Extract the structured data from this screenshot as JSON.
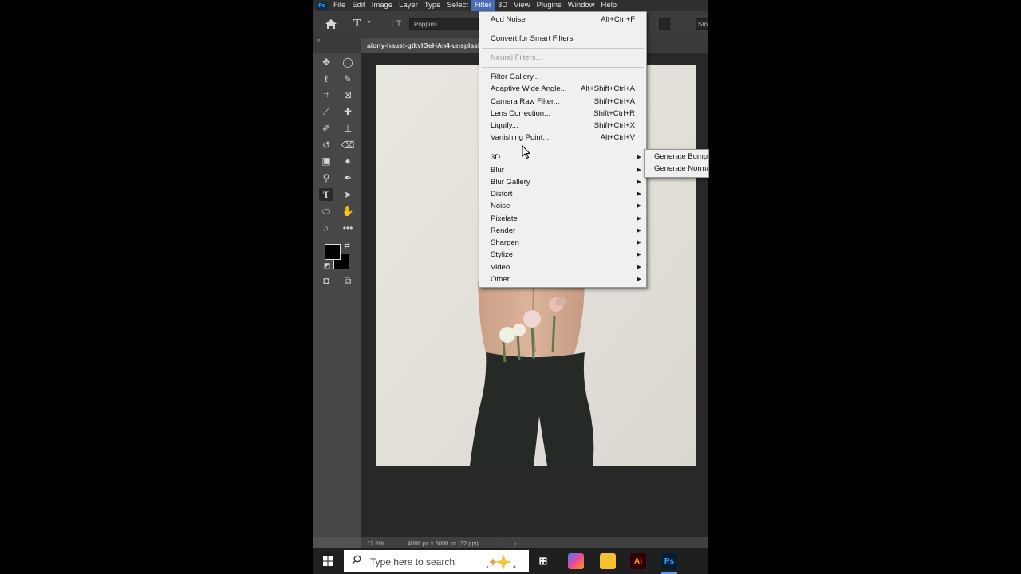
{
  "app": {
    "logo_text": "Ps"
  },
  "menubar": {
    "items": [
      "File",
      "Edit",
      "Image",
      "Layer",
      "Type",
      "Select",
      "Filter",
      "3D",
      "View",
      "Plugins",
      "Window",
      "Help"
    ],
    "active": "Filter"
  },
  "options": {
    "font": "Poppins",
    "right_field": "Sm"
  },
  "document": {
    "tab_title": "aiony-haust-gtkvlGeHAn4-unsplash"
  },
  "status": {
    "zoom": "12.5%",
    "doc_info": "4000 px x 5000 px (72 ppi)"
  },
  "filter_menu": {
    "group1": [
      {
        "label": "Add Noise",
        "shortcut": "Alt+Ctrl+F"
      }
    ],
    "group2": [
      {
        "label": "Convert for Smart Filters",
        "shortcut": ""
      }
    ],
    "group3": [
      {
        "label": "Neural Filters...",
        "shortcut": "",
        "disabled": true
      }
    ],
    "group4": [
      {
        "label": "Filter Gallery...",
        "shortcut": ""
      },
      {
        "label": "Adaptive Wide Angle...",
        "shortcut": "Alt+Shift+Ctrl+A"
      },
      {
        "label": "Camera Raw Filter...",
        "shortcut": "Shift+Ctrl+A"
      },
      {
        "label": "Lens Correction...",
        "shortcut": "Shift+Ctrl+R"
      },
      {
        "label": "Liquify...",
        "shortcut": "Shift+Ctrl+X"
      },
      {
        "label": "Vanishing Point...",
        "shortcut": "Alt+Ctrl+V"
      }
    ],
    "submenus": [
      "3D",
      "Blur",
      "Blur Gallery",
      "Distort",
      "Noise",
      "Pixelate",
      "Render",
      "Sharpen",
      "Stylize",
      "Video",
      "Other"
    ]
  },
  "submenu_3d": [
    "Generate Bump Map...",
    "Generate Normal Map..."
  ],
  "taskbar": {
    "search_placeholder": "Type here to search",
    "icons": [
      "task-view",
      "copilot",
      "file-explorer",
      "illustrator",
      "photoshop"
    ],
    "ai_label": "Ai",
    "ps_label": "Ps"
  },
  "colors": {
    "menu_highlight": "#4a6bb8",
    "menu_bg": "#f0f0f0",
    "canvas_bg": "#282828",
    "pants": "#262a26"
  }
}
